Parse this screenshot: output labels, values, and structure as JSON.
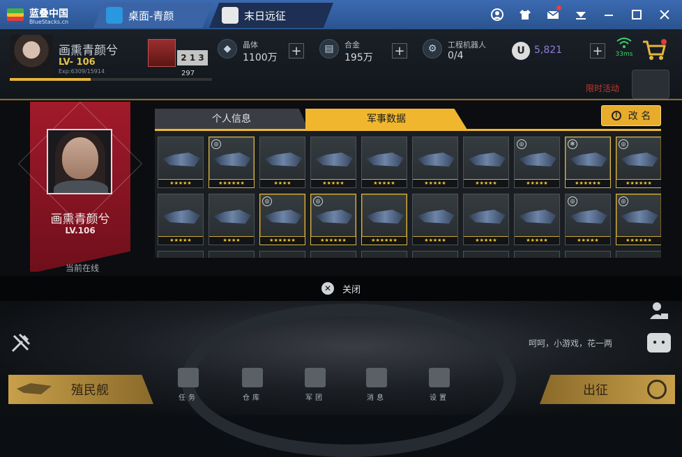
{
  "titlebar": {
    "brand": "蓝叠中国",
    "brand_sub": "BlueStacks.cn",
    "tabs": [
      {
        "label": "桌面-青颜",
        "icon": "home-icon"
      },
      {
        "label": "末日远征",
        "icon": "game-icon"
      }
    ],
    "icons": [
      "account-icon",
      "shirt-icon",
      "mail-icon",
      "dropdown-icon",
      "minimize-icon",
      "maximize-icon",
      "close-icon"
    ]
  },
  "hud": {
    "player_name": "画熏青颜兮",
    "level": "LV- 106",
    "exp": "Exp:6309/15914",
    "exp_progress": 0.4,
    "rank_number": "297",
    "rank_label": "2 1 3",
    "resources": [
      {
        "label": "晶体",
        "value": "1100万"
      },
      {
        "label": "合金",
        "value": "195万"
      },
      {
        "label": "工程机器人",
        "value": "0/4"
      }
    ],
    "u_coin_label": "U",
    "u_value": "5,821",
    "ping": "33ms",
    "event_label": "限时活动"
  },
  "profile": {
    "name": "画熏青颜兮",
    "level": "LV.106",
    "status": "当前在线"
  },
  "modal": {
    "tabs": [
      "个人信息",
      "军事数据"
    ],
    "active_tab": 1,
    "rename_label": "改 名",
    "close_label": "关闭",
    "ships": [
      {
        "stars": "★★★★★",
        "gold": false,
        "badge": ""
      },
      {
        "stars": "★★★★★★",
        "gold": true,
        "badge": "◎"
      },
      {
        "stars": "★★★★",
        "gold": false,
        "badge": ""
      },
      {
        "stars": "★★★★★",
        "gold": false,
        "badge": ""
      },
      {
        "stars": "★★★★★",
        "gold": false,
        "badge": ""
      },
      {
        "stars": "★★★★★",
        "gold": false,
        "badge": ""
      },
      {
        "stars": "★★★★★",
        "gold": false,
        "badge": ""
      },
      {
        "stars": "★★★★★",
        "gold": false,
        "badge": "◎"
      },
      {
        "stars": "★★★★★★",
        "gold": true,
        "badge": "✻"
      },
      {
        "stars": "★★★★★★",
        "gold": true,
        "badge": "◎"
      },
      {
        "stars": "★★★★★",
        "gold": false,
        "badge": ""
      },
      {
        "stars": "★★★★",
        "gold": false,
        "badge": ""
      },
      {
        "stars": "★★★★★★",
        "gold": true,
        "badge": "◎"
      },
      {
        "stars": "★★★★★★",
        "gold": true,
        "badge": "◎"
      },
      {
        "stars": "★★★★★★",
        "gold": true,
        "badge": ""
      },
      {
        "stars": "★★★★★",
        "gold": false,
        "badge": ""
      },
      {
        "stars": "★★★★★",
        "gold": false,
        "badge": ""
      },
      {
        "stars": "★★★★★",
        "gold": false,
        "badge": ""
      },
      {
        "stars": "★★★★★",
        "gold": false,
        "badge": "◎"
      },
      {
        "stars": "★★★★★★",
        "gold": true,
        "badge": "◎"
      }
    ]
  },
  "bottom": {
    "chat_text": "呵呵，小游戏，花一两",
    "colony_label": "殖民舰",
    "sortie_label": "出征",
    "nav": [
      "任务",
      "仓库",
      "军团",
      "消息",
      "设置"
    ]
  },
  "colors": {
    "accent": "#f0b72e",
    "profile_red": "#a11a2b",
    "titlebar_blue": "#2f5a97",
    "exp_bar": "#e6b63c"
  }
}
